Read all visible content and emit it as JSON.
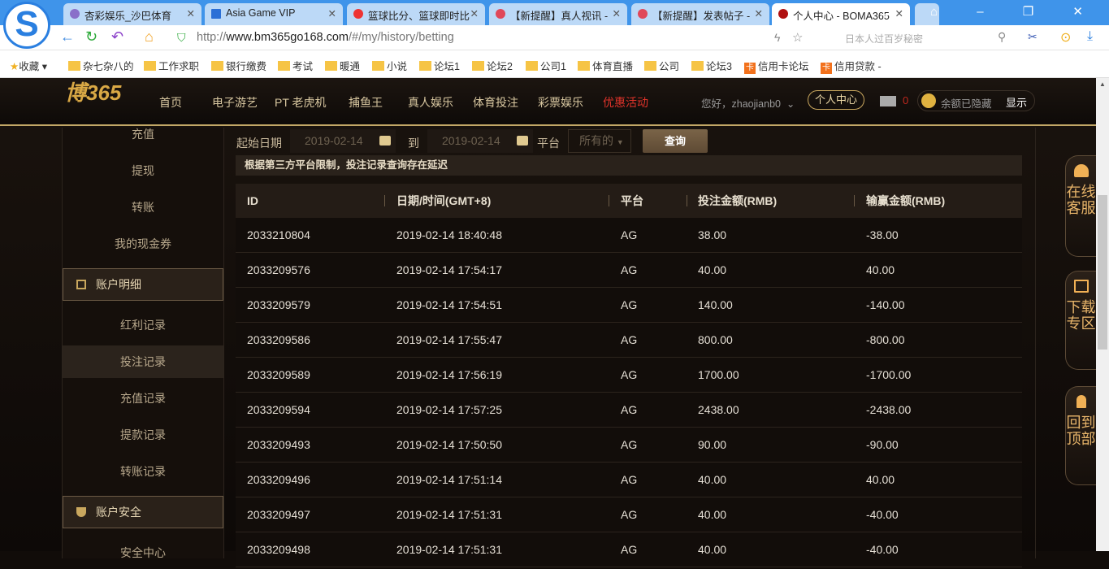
{
  "browser": {
    "tabs": [
      {
        "label": "杏彩娱乐_沙巴体育"
      },
      {
        "label": "Asia Game VIP"
      },
      {
        "label": "篮球比分、篮球即时比"
      },
      {
        "label": "【新提醒】真人视讯 -"
      },
      {
        "label": "【新提醒】发表帖子 -"
      },
      {
        "label": "个人中心 - BOMA365"
      }
    ],
    "url_prefix": "http://",
    "url_domain": "www.bm365go168.com",
    "url_path": "/#/my/history/betting",
    "search_placeholder": "日本人过百岁秘密",
    "bookmarks": [
      "收藏",
      "杂七杂八的",
      "工作求职",
      "银行缴费",
      "考试",
      "暖通",
      "小说",
      "论坛1",
      "论坛2",
      "公司1",
      "体育直播",
      "公司",
      "论坛3",
      "信用卡论坛",
      "信用贷款 -"
    ]
  },
  "site": {
    "logo": "博365",
    "menu": [
      "首页",
      "电子游艺",
      "PT 老虎机",
      "捕鱼王",
      "真人娱乐",
      "体育投注",
      "彩票娱乐",
      "优惠活动"
    ],
    "greeting": "您好，zhaojianb0",
    "personal_center": "个人中心",
    "mail_count": "0",
    "balance_hidden": "余额已隐藏",
    "show": "显示"
  },
  "sidebar": {
    "items_top": [
      "充值",
      "提现",
      "转账",
      "我的现金券"
    ],
    "section1": "账户明细",
    "items_mid": [
      "红利记录",
      "投注记录",
      "充值记录",
      "提款记录",
      "转账记录"
    ],
    "section2": "账户安全",
    "items_bottom": [
      "安全中心"
    ]
  },
  "filters": {
    "start_label": "起始日期",
    "start_date": "2019-02-14",
    "to_label": "到",
    "end_date": "2019-02-14",
    "platform_label": "平台",
    "platform_value": "所有的",
    "query": "查询"
  },
  "notice": "根据第三方平台限制，投注记录查询存在延迟",
  "table": {
    "headers": [
      "ID",
      "日期/时间(GMT+8)",
      "平台",
      "投注金额(RMB)",
      "输赢金额(RMB)"
    ],
    "rows": [
      [
        "2033210804",
        "2019-02-14 18:40:48",
        "AG",
        "38.00",
        "-38.00"
      ],
      [
        "2033209576",
        "2019-02-14 17:54:17",
        "AG",
        "40.00",
        "40.00"
      ],
      [
        "2033209579",
        "2019-02-14 17:54:51",
        "AG",
        "140.00",
        "-140.00"
      ],
      [
        "2033209586",
        "2019-02-14 17:55:47",
        "AG",
        "800.00",
        "-800.00"
      ],
      [
        "2033209589",
        "2019-02-14 17:56:19",
        "AG",
        "1700.00",
        "-1700.00"
      ],
      [
        "2033209594",
        "2019-02-14 17:57:25",
        "AG",
        "2438.00",
        "-2438.00"
      ],
      [
        "2033209493",
        "2019-02-14 17:50:50",
        "AG",
        "90.00",
        "-90.00"
      ],
      [
        "2033209496",
        "2019-02-14 17:51:14",
        "AG",
        "40.00",
        "40.00"
      ],
      [
        "2033209497",
        "2019-02-14 17:51:31",
        "AG",
        "40.00",
        "-40.00"
      ],
      [
        "2033209498",
        "2019-02-14 17:51:31",
        "AG",
        "40.00",
        "-40.00"
      ]
    ]
  },
  "float": [
    "在线客服",
    "下载专区",
    "回到顶部"
  ]
}
